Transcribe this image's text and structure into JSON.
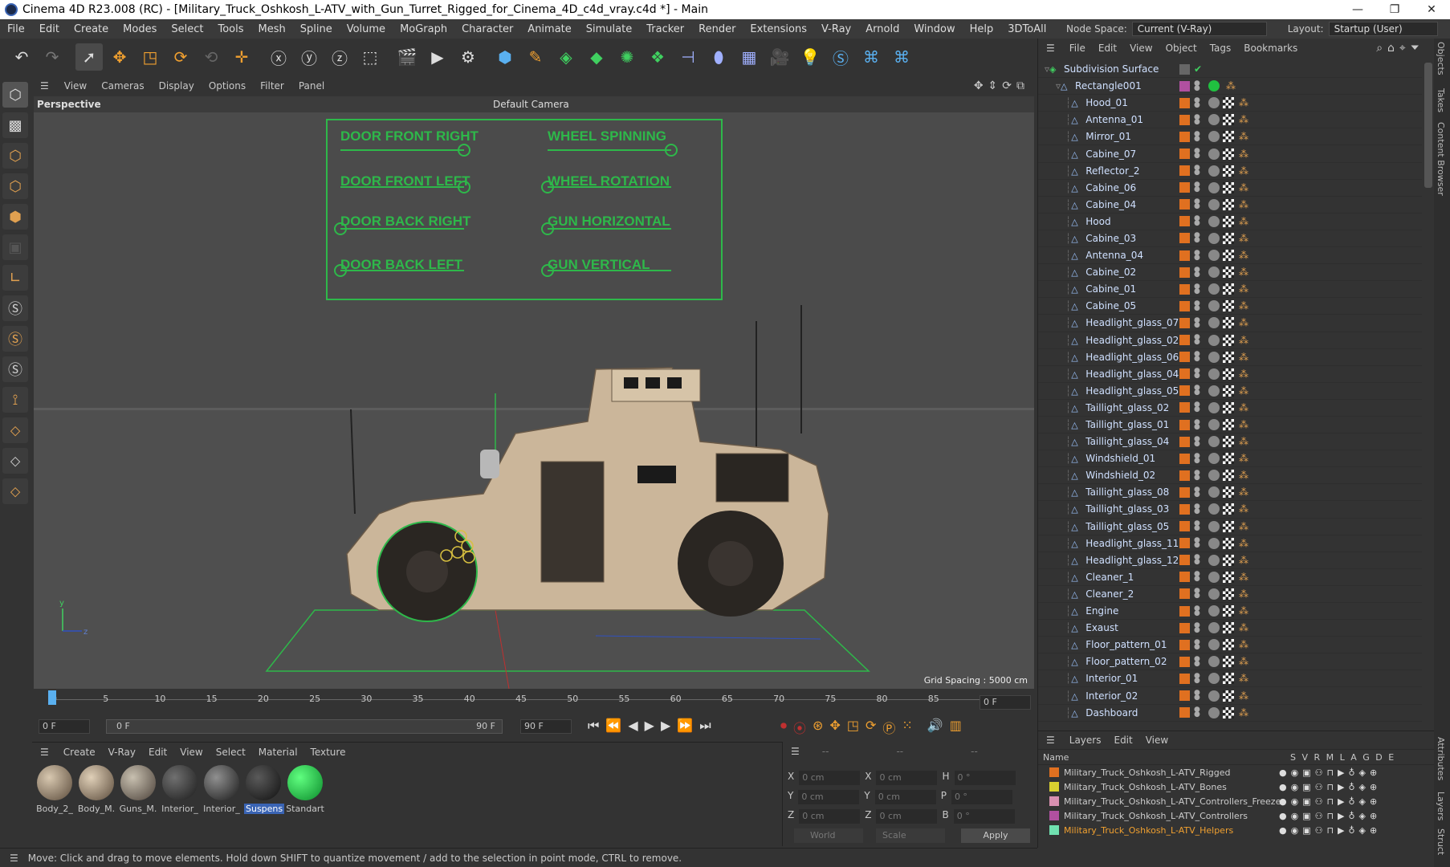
{
  "window": {
    "title": "Cinema 4D R23.008 (RC) - [Military_Truck_Oshkosh_L-ATV_with_Gun_Turret_Rigged_for_Cinema_4D_c4d_vray.c4d *] - Main",
    "min": "—",
    "max": "❐",
    "close": "✕"
  },
  "menubar": {
    "items": [
      "File",
      "Edit",
      "Create",
      "Modes",
      "Select",
      "Tools",
      "Mesh",
      "Spline",
      "Volume",
      "MoGraph",
      "Character",
      "Animate",
      "Simulate",
      "Tracker",
      "Render",
      "Extensions",
      "V-Ray",
      "Arnold",
      "Window",
      "Help",
      "3DToAll"
    ],
    "node_space_label": "Node Space:",
    "node_space_value": "Current (V-Ray)",
    "layout_label": "Layout:",
    "layout_value": "Startup (User)"
  },
  "viewport_menu": [
    "View",
    "Cameras",
    "Display",
    "Options",
    "Filter",
    "Panel"
  ],
  "viewport": {
    "name": "Perspective",
    "camera": "Default Camera",
    "grid_spacing": "Grid Spacing : 5000 cm"
  },
  "hud": {
    "labels": [
      "DOOR FRONT RIGHT",
      "WHEEL SPINNING",
      "DOOR FRONT LEFT",
      "WHEEL ROTATION",
      "DOOR BACK RIGHT",
      "GUN HORIZONTAL",
      "DOOR BACK LEFT",
      "GUN VERTICAL"
    ],
    "values": [
      1,
      1,
      1,
      0,
      0,
      0,
      0,
      0
    ]
  },
  "timeline": {
    "ticks": [
      "0",
      "5",
      "10",
      "15",
      "20",
      "25",
      "30",
      "35",
      "40",
      "45",
      "50",
      "55",
      "60",
      "65",
      "70",
      "75",
      "80",
      "85",
      "90"
    ],
    "current": "0 F"
  },
  "playbar": {
    "start": "0 F",
    "range_start": "0 F",
    "range_end": "90 F",
    "end": "90 F"
  },
  "materials": {
    "menu": [
      "Create",
      "V-Ray",
      "Edit",
      "View",
      "Select",
      "Material",
      "Texture"
    ],
    "items": [
      "Body_2_",
      "Body_M.",
      "Guns_M.",
      "Interior_",
      "Interior_",
      "Suspens",
      "Standart"
    ],
    "selected": "Suspens"
  },
  "coords": {
    "dashes": [
      "--",
      "--",
      "--"
    ],
    "rows": [
      {
        "a": "X",
        "av": "0 cm",
        "b": "X",
        "bv": "0 cm",
        "c": "H",
        "cv": "0 °"
      },
      {
        "a": "Y",
        "av": "0 cm",
        "b": "Y",
        "bv": "0 cm",
        "c": "P",
        "cv": "0 °"
      },
      {
        "a": "Z",
        "av": "0 cm",
        "b": "Z",
        "bv": "0 cm",
        "c": "B",
        "cv": "0 °"
      }
    ],
    "world": "World",
    "scale": "Scale",
    "apply": "Apply"
  },
  "status": "Move: Click and drag to move elements. Hold down SHIFT to quantize movement / add to the selection in point mode, CTRL to remove.",
  "object_manager": {
    "menu": [
      "File",
      "Edit",
      "View",
      "Object",
      "Tags",
      "Bookmarks"
    ],
    "root": "Subdivision Surface",
    "group": "Rectangle001",
    "objects": [
      "Hood_01",
      "Antenna_01",
      "Mirror_01",
      "Cabine_07",
      "Reflector_2",
      "Cabine_06",
      "Cabine_04",
      "Hood",
      "Cabine_03",
      "Antenna_04",
      "Cabine_02",
      "Cabine_01",
      "Cabine_05",
      "Headlight_glass_07",
      "Headlight_glass_02",
      "Headlight_glass_06",
      "Headlight_glass_04",
      "Headlight_glass_05",
      "Taillight_glass_02",
      "Taillight_glass_01",
      "Taillight_glass_04",
      "Windshield_01",
      "Windshield_02",
      "Taillight_glass_08",
      "Taillight_glass_03",
      "Taillight_glass_05",
      "Headlight_glass_11",
      "Headlight_glass_12",
      "Cleaner_1",
      "Cleaner_2",
      "Engine",
      "Exaust",
      "Floor_pattern_01",
      "Floor_pattern_02",
      "Interior_01",
      "Interior_02",
      "Dashboard"
    ]
  },
  "layers": {
    "menu": [
      "Layers",
      "Edit",
      "View"
    ],
    "header_name": "Name",
    "header_cols": "S V R M L A G D E",
    "items": [
      {
        "name": "Military_Truck_Oshkosh_L-ATV_Rigged",
        "color": "#e07020"
      },
      {
        "name": "Military_Truck_Oshkosh_L-ATV_Bones",
        "color": "#d8d030"
      },
      {
        "name": "Military_Truck_Oshkosh_L-ATV_Controllers_Freeze",
        "color": "#d890b0"
      },
      {
        "name": "Military_Truck_Oshkosh_L-ATV_Controllers",
        "color": "#b050a0"
      },
      {
        "name": "Military_Truck_Oshkosh_L-ATV_Helpers",
        "color": "#70e0b0"
      }
    ]
  },
  "sidetabs": [
    "Objects",
    "Takes",
    "Content Browser",
    "Attributes",
    "Layers",
    "Struct"
  ]
}
